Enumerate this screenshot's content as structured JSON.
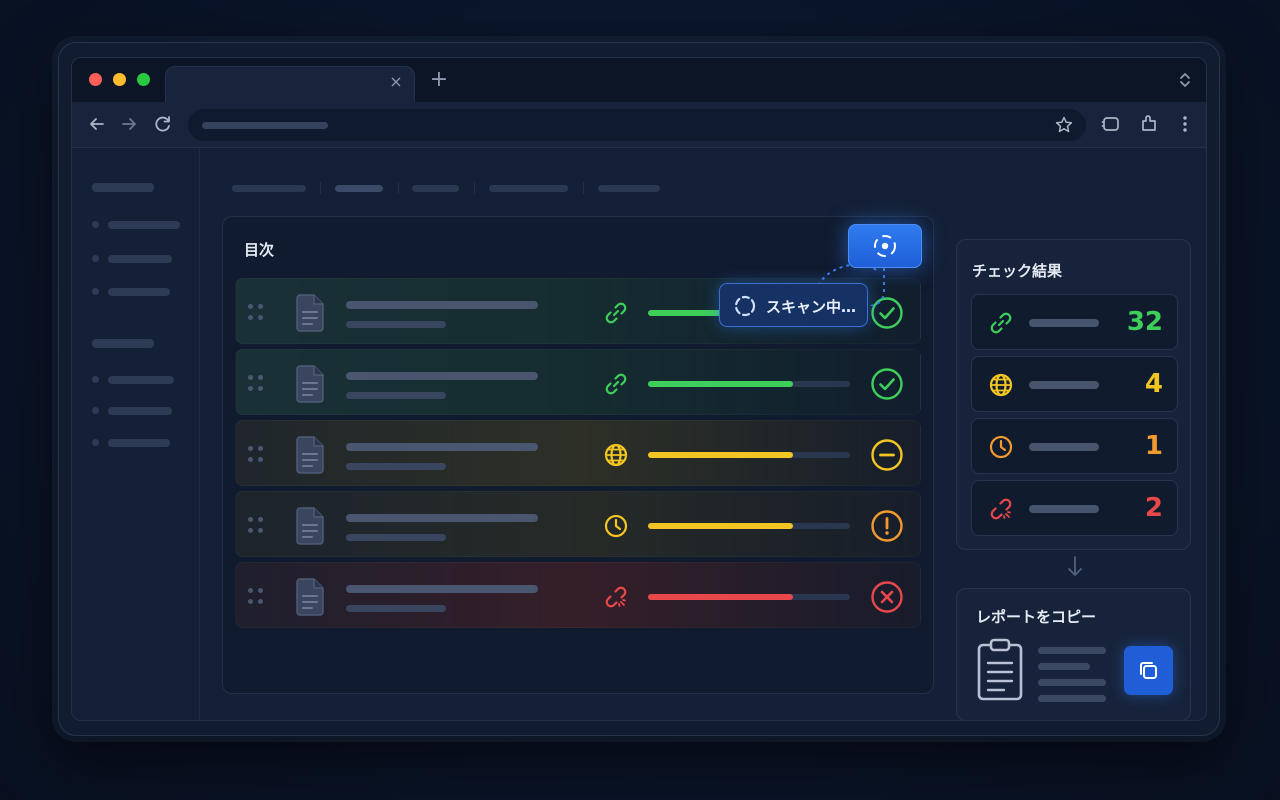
{
  "browser": {
    "tab_close_glyph": "×",
    "new_tab_glyph": "+"
  },
  "toc": {
    "title": "目次",
    "rows": [
      {
        "status_icon": "link-icon",
        "color": "#3ecf5a",
        "progress": 0.72,
        "result_icon": "check-circle-icon",
        "result_color": "#3ecf5a",
        "bg": "linear-gradient(90deg, rgba(40,90,70,0.35) 0%, rgba(25,60,50,0.55) 50%, rgba(20,40,40,0.25) 100%)"
      },
      {
        "status_icon": "link-icon",
        "color": "#3ecf5a",
        "progress": 0.72,
        "result_icon": "check-circle-icon",
        "result_color": "#3ecf5a",
        "bg": "linear-gradient(90deg, rgba(40,90,70,0.35) 0%, rgba(25,60,50,0.55) 50%, rgba(20,40,40,0.25) 100%)"
      },
      {
        "status_icon": "globe-icon",
        "color": "#f2c523",
        "progress": 0.72,
        "result_icon": "minus-circle-icon",
        "result_color": "#f2c523",
        "bg": "linear-gradient(90deg, rgba(60,60,40,0.35) 0%, rgba(75,70,30,0.5) 50%, rgba(40,40,30,0.25) 100%)"
      },
      {
        "status_icon": "clock-icon",
        "color": "#f2c523",
        "progress": 0.72,
        "result_icon": "exclamation-circle-icon",
        "result_color": "#f29a2e",
        "bg": "linear-gradient(90deg, rgba(50,55,40,0.35) 0%, rgba(65,62,30,0.45) 50%, rgba(40,40,30,0.25) 100%)"
      },
      {
        "status_icon": "broken-link-icon",
        "color": "#e8484a",
        "progress": 0.72,
        "result_icon": "x-circle-icon",
        "result_color": "#e8484a",
        "bg": "linear-gradient(90deg, rgba(60,40,45,0.35) 0%, rgba(90,35,35,0.5) 50%, rgba(45,30,35,0.25) 100%)"
      }
    ]
  },
  "scan": {
    "badge_label": "スキャン中…"
  },
  "results": {
    "title": "チェック結果",
    "items": [
      {
        "icon": "link-icon",
        "value": "32",
        "color": "#3ecf5a"
      },
      {
        "icon": "globe-icon",
        "value": "4",
        "color": "#f2c523"
      },
      {
        "icon": "clock-icon",
        "value": "1",
        "color": "#f29a2e"
      },
      {
        "icon": "broken-link-icon",
        "value": "2",
        "color": "#e8484a"
      }
    ]
  },
  "copy": {
    "title": "レポートをコピー"
  }
}
